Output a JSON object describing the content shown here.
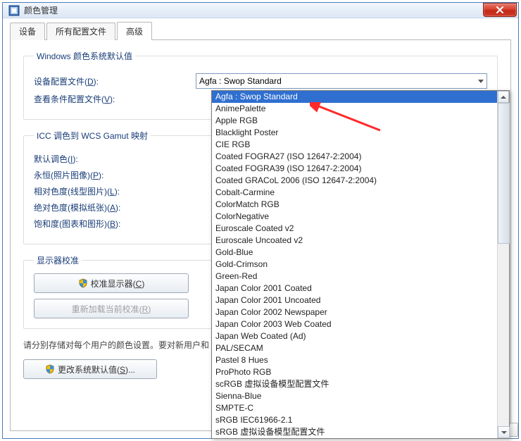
{
  "window": {
    "title": "颜色管理"
  },
  "tabs": {
    "devices": "设备",
    "allProfiles": "所有配置文件",
    "advanced": "高级"
  },
  "groups": {
    "defaults": "Windows 颜色系统默认值",
    "iccWcs": "ICC 调色到 WCS Gamut 映射",
    "calibration": "显示器校准"
  },
  "labels": {
    "deviceProfile": "设备配置文件(",
    "deviceProfile_hot": "D",
    "viewingProfile": "查看条件配置文件(",
    "viewingProfile_hot": "V",
    "defaultRendering": "默认调色(",
    "defaultRendering_hot": "I",
    "perceptual": "永恒(照片图像)(",
    "perceptual_hot": "P",
    "relative": "相对色度(线型图片)(",
    "relative_hot": "L",
    "absolute": "绝对色度(模拟纸张)(",
    "absolute_hot": "A",
    "saturation": "饱和度(图表和图形)(",
    "saturation_hot": "B",
    "close_paren_colon": "):"
  },
  "combo": {
    "selected": "Agfa : Swop Standard"
  },
  "buttons": {
    "calibrate": "校准显示器(",
    "calibrate_hot": "C",
    "reload": "重新加载当前校准(",
    "reload_hot": "R",
    "changeDefaults": "更改系统默认值(",
    "changeDefaults_hot": "S",
    "close_paren": ")",
    "close_paren_dots": ")..."
  },
  "note": "请分别存储对每个用户的颜色设置。要对新用户和",
  "dropdown": {
    "items": [
      "Agfa : Swop Standard",
      "AnimePalette",
      "Apple RGB",
      "Blacklight Poster",
      "CIE RGB",
      "Coated FOGRA27 (ISO 12647-2:2004)",
      "Coated FOGRA39 (ISO 12647-2:2004)",
      "Coated GRACoL 2006 (ISO 12647-2:2004)",
      "Cobalt-Carmine",
      "ColorMatch RGB",
      "ColorNegative",
      "Euroscale Coated v2",
      "Euroscale Uncoated v2",
      "Gold-Blue",
      "Gold-Crimson",
      "Green-Red",
      "Japan Color 2001 Coated",
      "Japan Color 2001 Uncoated",
      "Japan Color 2002 Newspaper",
      "Japan Color 2003 Web Coated",
      "Japan Web Coated (Ad)",
      "PAL/SECAM",
      "Pastel 8 Hues",
      "ProPhoto RGB",
      "scRGB 虚拟设备模型配置文件",
      "Sienna-Blue",
      "SMPTE-C",
      "sRGB IEC61966-2.1",
      "sRGB 虚拟设备模型配置文件"
    ],
    "selectedIndex": 0
  }
}
